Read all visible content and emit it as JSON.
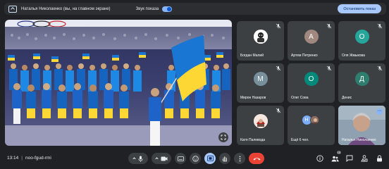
{
  "banner": {
    "presenter": "Наталья Николаенко (вы, на главном экране)",
    "sound_label": "Звук показа",
    "sound_on": true,
    "stop_label": "Остановить показ"
  },
  "participants": [
    {
      "name": "Богдан Малий",
      "initial": "",
      "color": "#ffffff",
      "kind": "photo"
    },
    {
      "name": "Артем Петренко",
      "initial": "А",
      "color": "#a1887f",
      "kind": "letter"
    },
    {
      "name": "Оля Жмыкова",
      "initial": "О",
      "color": "#26a69a",
      "kind": "letter"
    },
    {
      "name": "Мирон Назаров",
      "initial": "М",
      "color": "#78909c",
      "kind": "letter"
    },
    {
      "name": "Олег Сова",
      "initial": "О",
      "color": "#00897b",
      "kind": "letter"
    },
    {
      "name": "Денис",
      "initial": "Д",
      "color": "#2e7d6f",
      "kind": "letter"
    },
    {
      "name": "Катя Палевода",
      "initial": "",
      "color": "#ffffff",
      "kind": "photo"
    },
    {
      "name": "Ещё 6 чел.",
      "initial": "Н",
      "color": "#7cacf8",
      "kind": "more"
    },
    {
      "name": "Наталья Николаенко",
      "initial": "",
      "color": "#6b7b8c",
      "kind": "self"
    }
  ],
  "bottom": {
    "time": "13:14",
    "meeting_code": "noo-fgud-rmi",
    "participants_count": "15"
  },
  "icons": {
    "mic": "mic-icon",
    "camera": "camera-icon",
    "captions": "captions-icon",
    "emoji": "emoji-icon",
    "present": "present-icon",
    "hand": "raise-hand-icon",
    "more": "more-vert-icon",
    "leave": "call-end-icon",
    "info": "info-icon",
    "people": "people-icon",
    "chat": "chat-icon",
    "activities": "activities-icon",
    "lock": "lock-icon"
  }
}
